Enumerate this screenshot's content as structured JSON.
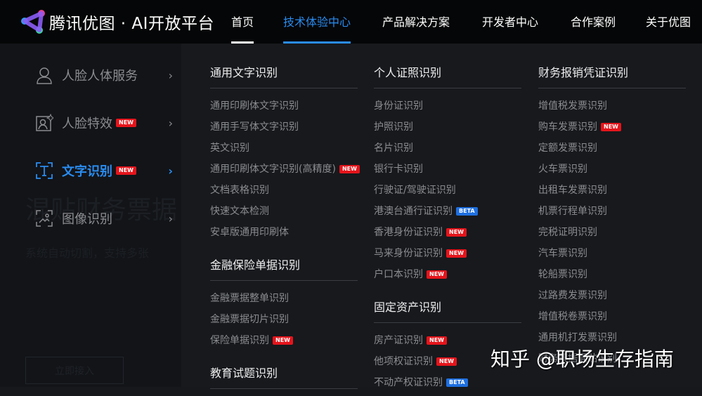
{
  "nav": {
    "brand": "腾讯优图 · AI开放平台",
    "items": [
      {
        "label": "首页",
        "underline": true
      },
      {
        "label": "技术体验中心",
        "active": true
      },
      {
        "label": "产品解决方案"
      },
      {
        "label": "开发者中心"
      },
      {
        "label": "合作案例"
      },
      {
        "label": "关于优图"
      }
    ]
  },
  "hero": {
    "title": "混贴财务票据",
    "subtitle": "系统自动切割，支持多张",
    "button": "立即接入"
  },
  "categories": [
    {
      "label": "人脸人体服务",
      "icon": "user-icon"
    },
    {
      "label": "人脸特效",
      "badge": "NEW",
      "icon": "face-sparkle-icon"
    },
    {
      "label": "文字识别",
      "badge": "NEW",
      "icon": "text-scan-icon",
      "active": true
    },
    {
      "label": "图像识别",
      "icon": "image-scan-icon"
    }
  ],
  "columns": [
    [
      {
        "title": "通用文字识别",
        "items": [
          {
            "label": "通用印刷体文字识别"
          },
          {
            "label": "通用手写体文字识别"
          },
          {
            "label": "英文识别"
          },
          {
            "label": "通用印刷体文字识别(高精度)",
            "badge": "NEW"
          },
          {
            "label": "文档表格识别"
          },
          {
            "label": "快速文本检测"
          },
          {
            "label": "安卓版通用印刷体"
          }
        ]
      },
      {
        "title": "金融保险单据识别",
        "items": [
          {
            "label": "金融票据整单识别"
          },
          {
            "label": "金融票据切片识别"
          },
          {
            "label": "保险单据识别",
            "badge": "NEW"
          }
        ]
      },
      {
        "title": "教育试题识别",
        "items": []
      }
    ],
    [
      {
        "title": "个人证照识别",
        "items": [
          {
            "label": "身份证识别"
          },
          {
            "label": "护照识别"
          },
          {
            "label": "名片识别"
          },
          {
            "label": "银行卡识别"
          },
          {
            "label": "行驶证/驾驶证识别"
          },
          {
            "label": "港澳台通行证识别",
            "badge": "BETA"
          },
          {
            "label": "香港身份证识别",
            "badge": "NEW"
          },
          {
            "label": "马来身份证识别",
            "badge": "NEW"
          },
          {
            "label": "户口本识别",
            "badge": "NEW"
          }
        ]
      },
      {
        "title": "固定资产识别",
        "items": [
          {
            "label": "房产证识别",
            "badge": "NEW"
          },
          {
            "label": "他项权证识别",
            "badge": "NEW"
          },
          {
            "label": "不动产权证识别",
            "badge": "BETA"
          }
        ]
      }
    ],
    [
      {
        "title": "财务报销凭证识别",
        "items": [
          {
            "label": "增值税发票识别"
          },
          {
            "label": "购车发票识别",
            "badge": "NEW"
          },
          {
            "label": "定额发票识别"
          },
          {
            "label": "火车票识别"
          },
          {
            "label": "出租车发票识别"
          },
          {
            "label": "机票行程单识别"
          },
          {
            "label": "完税证明识别"
          },
          {
            "label": "汽车票识别"
          },
          {
            "label": "轮船票识别"
          },
          {
            "label": "过路费发票识别"
          },
          {
            "label": "增值税卷票识别"
          },
          {
            "label": "通用机打发票识别"
          },
          {
            "label": "财务票据混贴识别"
          }
        ]
      }
    ]
  ],
  "watermark": "知乎 @职场生存指南",
  "colors": {
    "accent": "#2a8cf0",
    "badge_new": "#e5141b",
    "badge_beta": "#1e6fe0"
  }
}
